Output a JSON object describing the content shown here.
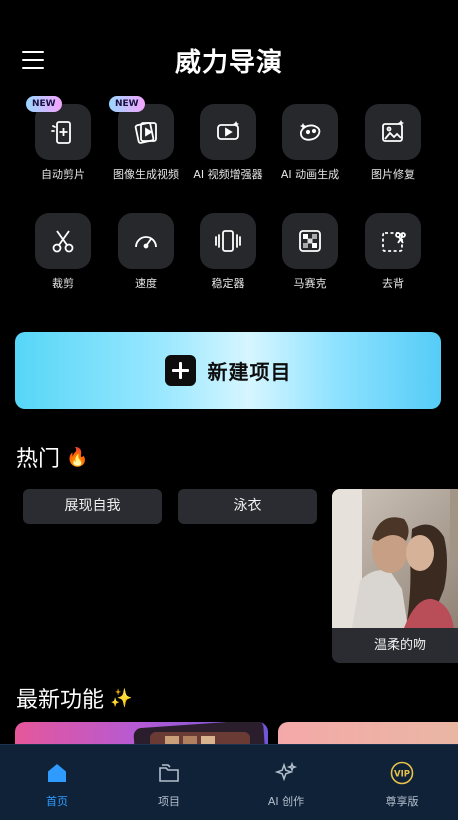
{
  "header": {
    "title": "威力导演"
  },
  "tools": [
    {
      "label": "自动剪片",
      "icon": "auto-cut-icon",
      "badge": "NEW"
    },
    {
      "label": "图像生成视频",
      "icon": "image-to-video-icon",
      "badge": "NEW"
    },
    {
      "label": "AI 视频增强器",
      "icon": "video-enhancer-icon"
    },
    {
      "label": "AI 动画生成",
      "icon": "ai-animation-icon"
    },
    {
      "label": "图片修复",
      "icon": "photo-repair-icon"
    },
    {
      "label": "裁剪",
      "icon": "scissors-icon"
    },
    {
      "label": "速度",
      "icon": "speedometer-icon"
    },
    {
      "label": "稳定器",
      "icon": "stabilizer-icon"
    },
    {
      "label": "马赛克",
      "icon": "mosaic-icon"
    },
    {
      "label": "去背",
      "icon": "remove-background-icon"
    }
  ],
  "new_project": {
    "label": "新建项目"
  },
  "hot": {
    "title": "热门",
    "emoji": "🔥",
    "tags": [
      "展现自我",
      "泳衣"
    ],
    "card_caption": "温柔的吻"
  },
  "latest": {
    "title": "最新功能",
    "emoji": "✨"
  },
  "tabbar": {
    "tabs": [
      {
        "label": "首页",
        "icon": "home-icon",
        "active": true
      },
      {
        "label": "项目",
        "icon": "folder-icon"
      },
      {
        "label": "AI 创作",
        "icon": "sparkle-icon"
      },
      {
        "label": "尊享版",
        "icon": "vip-crown-icon"
      }
    ]
  },
  "colors": {
    "accent": "#2f9bff",
    "tabbar_bg": "#0f2238",
    "tile_bg": "#26282c",
    "button_gradient_mid": "#d6f6ff"
  }
}
